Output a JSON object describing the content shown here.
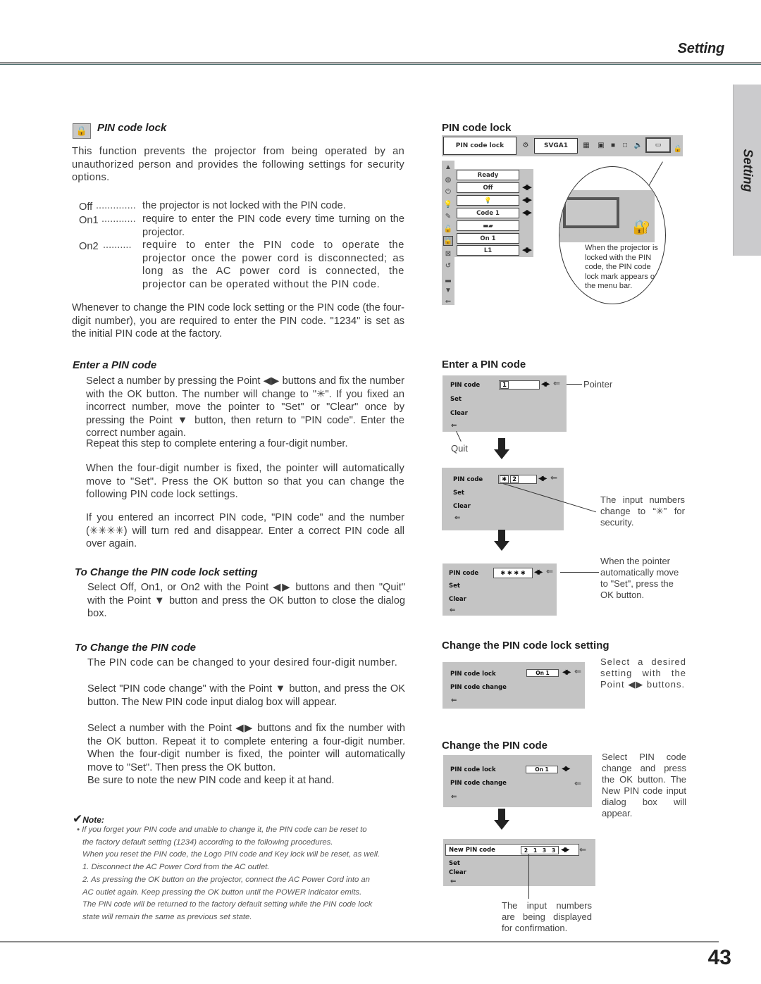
{
  "header": {
    "section_title": "Setting"
  },
  "side_tab": {
    "label": "Setting"
  },
  "left": {
    "pin_lock": {
      "icon": "pin-lock-icon",
      "heading": "PIN code lock",
      "intro": "This function prevents the projector from being operated by an unauthorized person and provides the following settings for security options.",
      "options": [
        {
          "key": "Off",
          "dots": "..............",
          "desc": "the projector is not locked with the PIN code."
        },
        {
          "key": "On1",
          "dots": "............",
          "desc": "require to enter the PIN code every time turning on the projector."
        },
        {
          "key": "On2",
          "dots": "..........",
          "desc": "require to enter the PIN code to operate the projector once the power cord is disconnected; as long as the AC power cord is connected, the projector can be operated without the PIN code."
        }
      ],
      "outro": "Whenever to change the PIN code lock setting or the PIN code (the four-digit number), you are required to enter the PIN code. \"1234\" is set as the initial PIN code at the factory."
    },
    "enter_pin": {
      "heading": "Enter a PIN code",
      "p1": "Select a number by pressing the Point ◀▶ buttons and fix the number with the OK button.  The number will change to \"✳\".  If you fixed an incorrect number, move the pointer to \"Set\" or \"Clear\" once by pressing the Point ▼ button, then return to \"PIN code\".  Enter the correct number again.",
      "p1b": "Repeat this step to complete entering a four-digit number.",
      "p2": "When the four-digit number is fixed, the pointer will automatically move to \"Set\".  Press the OK button so that you can change the following PIN code lock settings.",
      "p3": "If you entered an incorrect PIN code, \"PIN code\" and the number (✳✳✳✳) will turn red and disappear.  Enter a correct PIN code all over again."
    },
    "change_lock": {
      "heading": "To Change the PIN code lock setting",
      "p1": "Select Off, On1, or On2 with the Point ◀▶ buttons and then \"Quit\" with the Point ▼ button and press the OK button to close the dialog box."
    },
    "change_code": {
      "heading": "To Change the PIN code",
      "p1": "The PIN code can be changed to your desired four-digit number.",
      "p2": "Select \"PIN code change\" with the Point ▼ button, and press the OK button.  The New PIN code input dialog box will appear.",
      "p3": "Select a number with the Point ◀▶ buttons and fix the number with the OK button. Repeat it to complete entering a four-digit number.  When the four-digit number is fixed, the pointer will automatically move to \"Set\".  Then press the OK button.",
      "p4": "Be sure to note the new PIN code and keep it at hand."
    },
    "note": {
      "title": "Note:",
      "lines": [
        "• If you forget your PIN code and unable to change it, the  PIN code can be reset to",
        "the factory default setting (1234) according to the following procedures.",
        "When you reset the PIN code, the Logo PIN code and Key lock will be reset, as well.",
        "1. Disconnect the AC Power Cord from the AC outlet.",
        "2. As pressing the OK button on the projector, connect the AC Power Cord into an",
        "AC outlet again.  Keep pressing the OK button until the POWER indicator emits.",
        "The PIN code will be returned to the factory default setting while the PIN code lock",
        "state will remain the same as previous set state."
      ]
    }
  },
  "right": {
    "pin_lock_fig": {
      "heading": "PIN code lock",
      "menubar": {
        "title": "PIN code lock",
        "source": "SVGA1"
      },
      "menu_items": [
        "Ready",
        "Off",
        "💡",
        "Code 1",
        "▬▰",
        "On 1",
        "L1"
      ],
      "menu_arrows": [
        false,
        true,
        true,
        true,
        false,
        false,
        true
      ],
      "callout": "When the projector is locked with the PIN code,  the PIN code lock mark appears  on the menu bar."
    },
    "enter_pin_fig": {
      "heading": "Enter a PIN code",
      "dialog1": {
        "label": "PIN code",
        "value": "1",
        "set": "Set",
        "clear": "Clear"
      },
      "pointer_label": "Pointer",
      "quit_label": "Quit",
      "dialog2": {
        "label": "PIN code",
        "value1": "✱",
        "value2": "2",
        "set": "Set",
        "clear": "Clear"
      },
      "caption2": "The input numbers change to “✳” for security.",
      "dialog3": {
        "label": "PIN code",
        "value": "✱  ✱  ✱  ✱",
        "set": "Set",
        "clear": "Clear"
      },
      "caption3": "When the pointer automatically move to \"Set\", press the OK button."
    },
    "change_lock_fig": {
      "heading": "Change the PIN code lock setting",
      "dialog": {
        "lock_label": "PIN code lock",
        "lock_value": "On 1",
        "change_label": "PIN code change"
      },
      "caption": "Select a desired setting with the Point ◀▶ buttons."
    },
    "change_code_fig": {
      "heading": "Change the PIN code",
      "dialog1": {
        "lock_label": "PIN code lock",
        "lock_value": "On 1",
        "change_label": "PIN code change"
      },
      "caption1": "Select PIN code change and press the OK button.  The New PIN code input dialog box will appear.",
      "dialog2": {
        "label": "New PIN code",
        "value": "2   1   3   3",
        "set": "Set",
        "clear": "Clear"
      },
      "caption2": "The input numbers are being displayed for confirmation."
    }
  },
  "footer": {
    "page_number": "43"
  }
}
